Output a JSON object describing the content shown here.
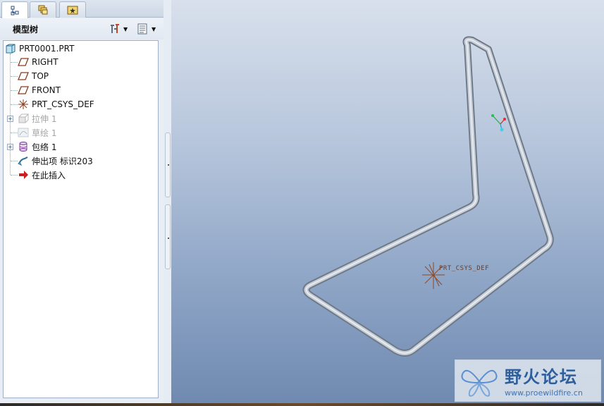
{
  "nav_tabs": [
    {
      "name": "model-tree-tab",
      "icon": "tree-icon",
      "active": true
    },
    {
      "name": "layers-tab",
      "icon": "layers-icon",
      "active": false
    },
    {
      "name": "favorites-tab",
      "icon": "star-folder-icon",
      "active": false
    }
  ],
  "tree_panel": {
    "title": "模型树",
    "settings_icon": "tools-icon",
    "show_icon": "list-icon"
  },
  "tree": [
    {
      "label": "PRT0001.PRT",
      "icon": "part-icon",
      "dim": false,
      "expander": false
    },
    {
      "label": "RIGHT",
      "icon": "datum-plane-icon",
      "dim": false,
      "expander": false
    },
    {
      "label": "TOP",
      "icon": "datum-plane-icon",
      "dim": false,
      "expander": false
    },
    {
      "label": "FRONT",
      "icon": "datum-plane-icon",
      "dim": false,
      "expander": false
    },
    {
      "label": "PRT_CSYS_DEF",
      "icon": "csys-icon",
      "dim": false,
      "expander": false
    },
    {
      "label": "拉伸 1",
      "icon": "extrude-icon",
      "dim": true,
      "expander": true
    },
    {
      "label": "草绘 1",
      "icon": "sketch-icon",
      "dim": true,
      "expander": false
    },
    {
      "label": "包络 1",
      "icon": "wrap-icon",
      "dim": false,
      "expander": true
    },
    {
      "label": "伸出项 标识203",
      "icon": "sweep-icon",
      "dim": false,
      "expander": false
    },
    {
      "label": "在此插入",
      "icon": "insert-arrow-icon",
      "dim": false,
      "expander": false
    }
  ],
  "viewport": {
    "csys_label": "PRT_CSYS_DEF",
    "background_top": "#d8e0ec",
    "background_bottom": "#6f89b0",
    "tube_color": "#a9b3bf"
  },
  "watermark": {
    "title": "野火论坛",
    "url": "www.proewildfire.cn"
  }
}
